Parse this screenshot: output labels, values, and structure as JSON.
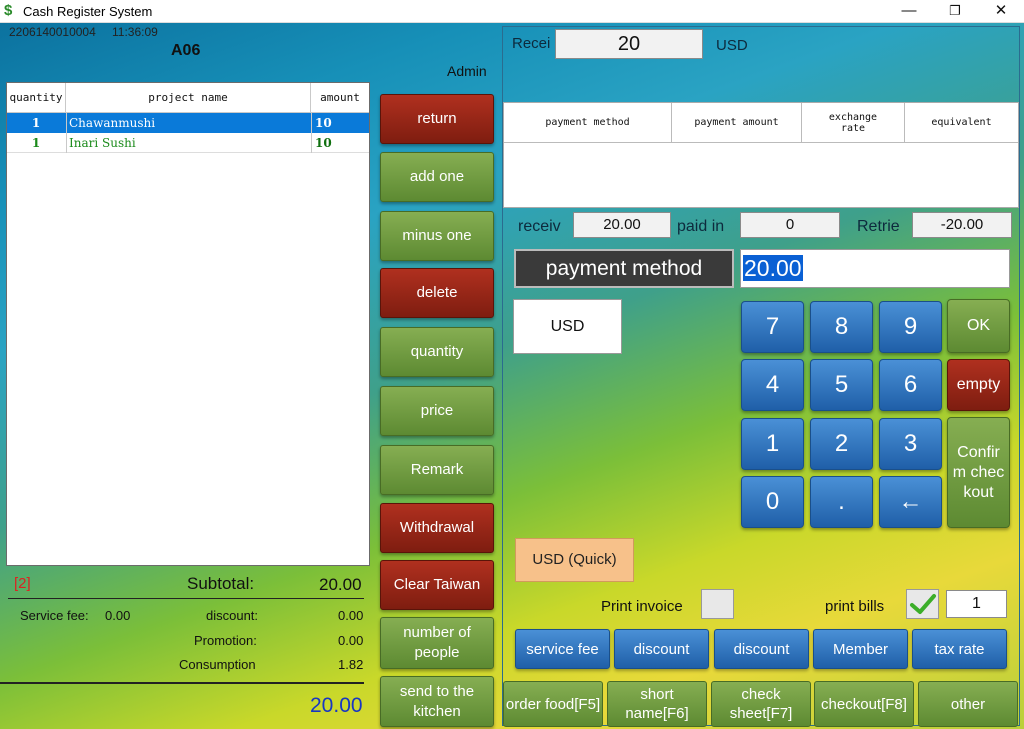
{
  "window": {
    "title": "Cash Register System",
    "minimize": "—",
    "maximize": "❐",
    "close": "✕",
    "app_icon": "$"
  },
  "header": {
    "order_no": "2206140010004",
    "time": "11:36:09",
    "table": "A06",
    "user": "Admin"
  },
  "order_table": {
    "columns": [
      "quantity",
      "project name",
      "amount"
    ],
    "rows": [
      {
        "qty": "1",
        "name": "Chawanmushi",
        "amount": "10"
      },
      {
        "qty": "1",
        "name": "Inari Sushi",
        "amount": "10"
      }
    ]
  },
  "summary": {
    "count": "[2]",
    "subtotal_label": "Subtotal:",
    "subtotal": "20.00",
    "service_fee_label": "Service fee:",
    "service_fee": "0.00",
    "discount_label": "discount:",
    "discount": "0.00",
    "promotion_label": "Promotion:",
    "promotion": "0.00",
    "consumption_label": "Consumption",
    "consumption": "1.82",
    "total": "20.00"
  },
  "mid_buttons": [
    "return",
    "add one",
    "minus one",
    "delete",
    "quantity",
    "price",
    "Remark",
    "Withdrawal",
    "Clear Taiwan",
    "number of people",
    "send to the kitchen"
  ],
  "payment": {
    "receive_label": "Recei",
    "receive_value": "20",
    "currency": "USD",
    "table_columns": [
      "payment method",
      "payment amount",
      "exchange rate",
      "equivalent"
    ],
    "receiv_label": "receiv",
    "receiv_value": "20.00",
    "paid_label": "paid in",
    "paid_value": "0",
    "retrie_label": "Retrie",
    "retrie_value": "-20.00",
    "method_label": "payment method",
    "amount_input": "20.00",
    "method_option": "USD",
    "quick_button": "USD (Quick)",
    "print_invoice_label": "Print invoice",
    "print_bills_label": "print bills",
    "print_copies": "1"
  },
  "keypad": {
    "keys": [
      "7",
      "8",
      "9",
      "4",
      "5",
      "6",
      "1",
      "2",
      "3",
      "0",
      ".",
      "←"
    ],
    "ok": "OK",
    "empty": "empty",
    "confirm": "Confirm checkout"
  },
  "blue_buttons": [
    "service fee",
    "discount",
    "discount",
    "Member",
    "tax rate"
  ],
  "nav_buttons": [
    "order food[F5]",
    "short name[F6]",
    "check sheet[F7]",
    "checkout[F8]",
    "other"
  ],
  "colors": {
    "accent_blue": "#0a7ad9",
    "red_button": "#9a2818",
    "green_button": "#6f9a3e",
    "key_blue": "#2f74c0"
  }
}
